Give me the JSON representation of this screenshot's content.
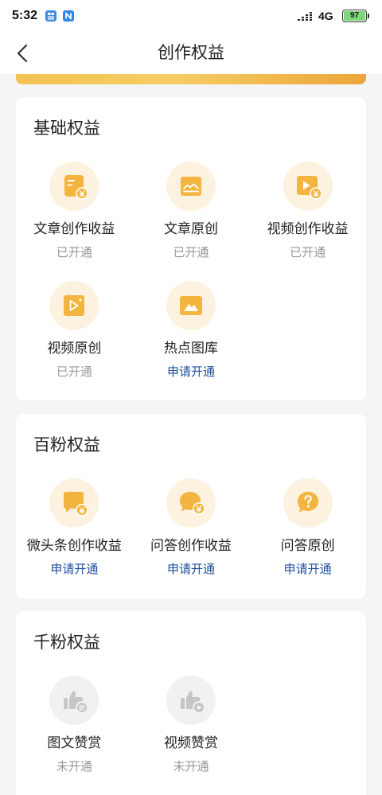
{
  "status_bar": {
    "time": "5:32",
    "network": "4G",
    "battery": "97",
    "notification_icons": [
      "app-notification-icon",
      "n-app-icon"
    ],
    "signal_icon": "signal-icon"
  },
  "header": {
    "back_icon": "chevron-left-icon",
    "title": "创作权益"
  },
  "colors": {
    "page_background": "#f5f5f5",
    "card_background": "#ffffff",
    "gold_icon": "#f3b53f",
    "gold_icon_background": "#fdf2df",
    "disabled_icon": "#c6c6c6",
    "disabled_icon_background": "#f1f1f1",
    "link_blue": "#1e4f9c",
    "muted_text": "#999999",
    "battery_fill": "#7bd77a"
  },
  "sections": [
    {
      "title": "基础权益",
      "items": [
        {
          "label": "文章创作收益",
          "status": "已开通",
          "icon": "article-income-icon"
        },
        {
          "label": "文章原创",
          "status": "已开通",
          "icon": "article-original-icon"
        },
        {
          "label": "视频创作收益",
          "status": "已开通",
          "icon": "video-income-icon"
        },
        {
          "label": "视频原创",
          "status": "已开通",
          "icon": "video-original-icon"
        },
        {
          "label": "热点图库",
          "status": "申请开通",
          "icon": "image-gallery-icon"
        }
      ]
    },
    {
      "title": "百粉权益",
      "items": [
        {
          "label": "微头条创作收益",
          "status": "申请开通",
          "icon": "micro-post-income-icon"
        },
        {
          "label": "问答创作收益",
          "status": "申请开通",
          "icon": "qa-income-icon"
        },
        {
          "label": "问答原创",
          "status": "申请开通",
          "icon": "qa-original-icon"
        }
      ]
    },
    {
      "title": "千粉权益",
      "items": [
        {
          "label": "图文赞赏",
          "status": "未开通",
          "icon": "article-reward-icon"
        },
        {
          "label": "视频赞赏",
          "status": "未开通",
          "icon": "video-reward-icon"
        }
      ]
    }
  ]
}
